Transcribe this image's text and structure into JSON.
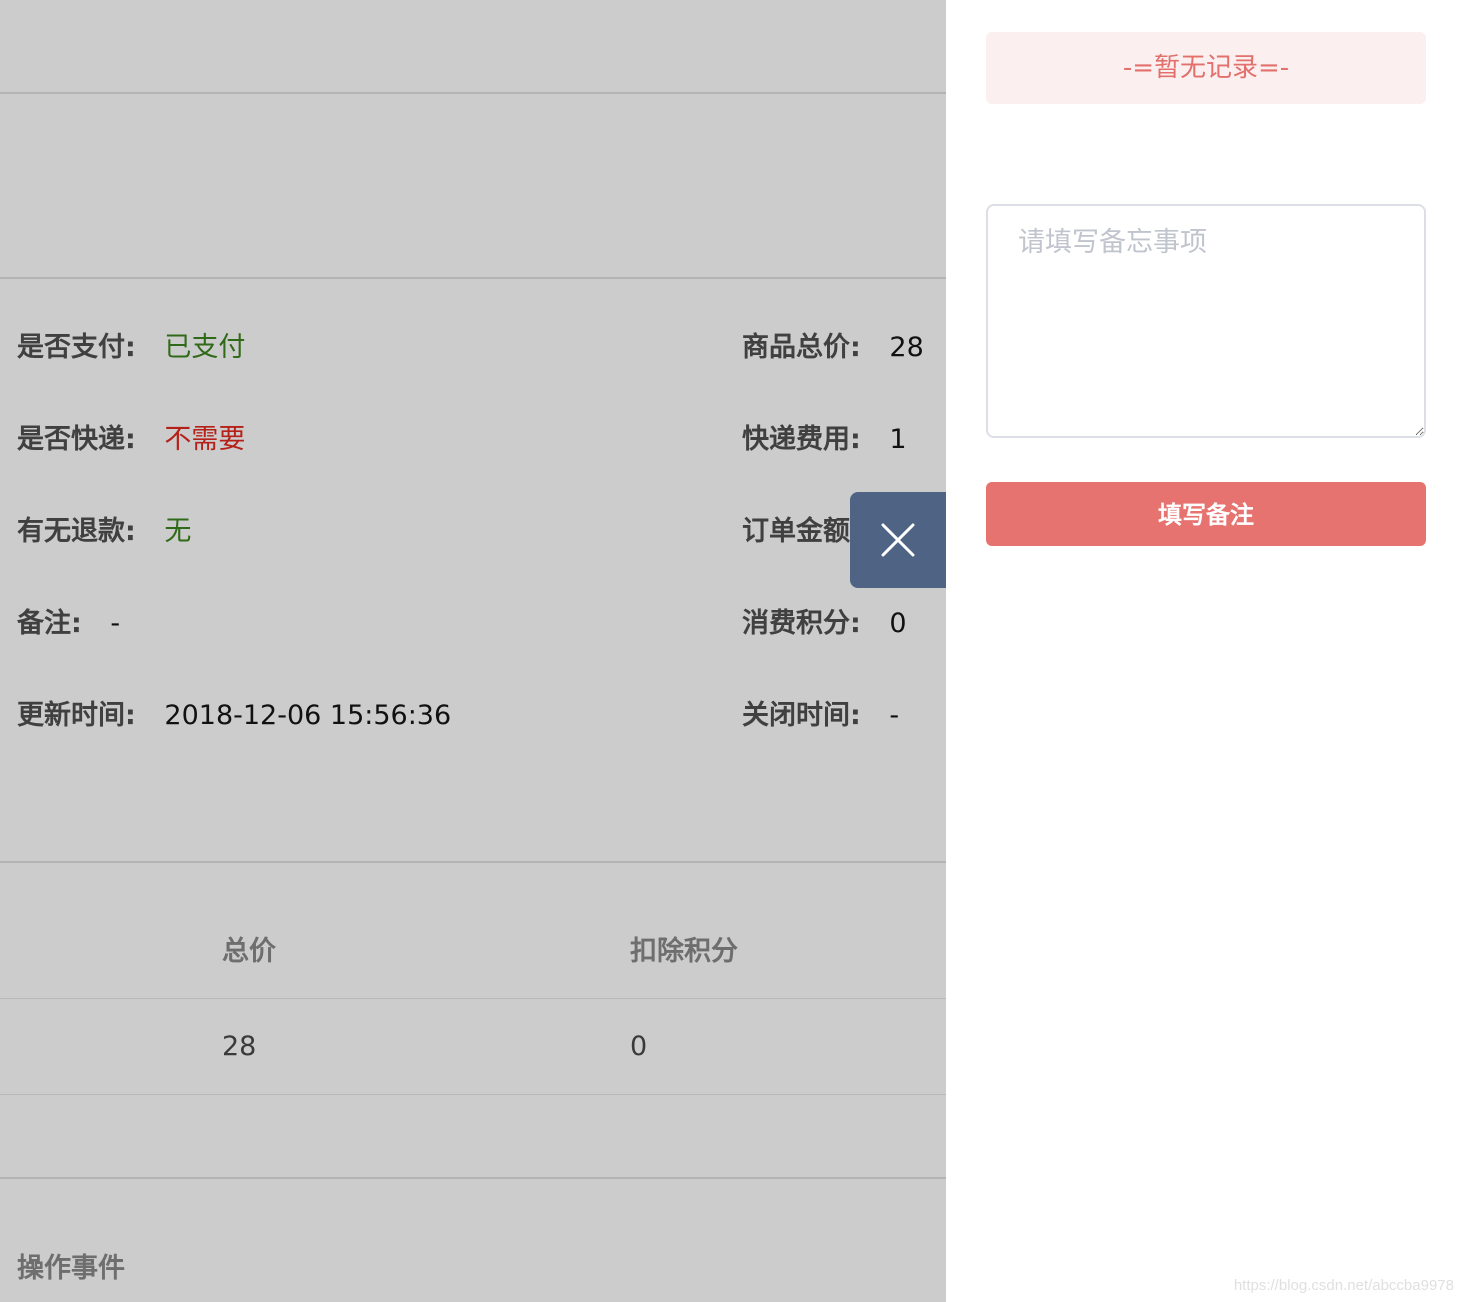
{
  "order_info": {
    "paid_label": "是否支付:",
    "paid_value": "已支付",
    "express_label": "是否快递:",
    "express_value": "不需要",
    "refund_label": "有无退款:",
    "refund_value": "无",
    "remark_label": "备注:",
    "remark_value": "-",
    "updated_label": "更新时间:",
    "updated_value": "2018-12-06 15:56:36",
    "goods_total_label": "商品总价:",
    "goods_total_value": "28",
    "express_fee_label": "快递费用:",
    "express_fee_value": "1",
    "order_amount_label": "订单金额",
    "points_label": "消费积分:",
    "points_value": "0",
    "closed_label": "关闭时间:",
    "closed_value": "-"
  },
  "summary_table": {
    "headers": [
      "总价",
      "扣除积分"
    ],
    "row": [
      "28",
      "0"
    ]
  },
  "events_section": {
    "title": "操作事件"
  },
  "drawer": {
    "empty_text": "-=暂无记录=-",
    "memo_placeholder": "请填写备忘事项",
    "submit_label": "填写备注"
  },
  "watermark": "https://blog.csdn.net/abccba9978",
  "colors": {
    "overlay": "#cccccc",
    "close_tab": "#4f6485",
    "accent": "#e6736f",
    "paid_green": "#2f6a18",
    "express_red": "#b52018"
  }
}
